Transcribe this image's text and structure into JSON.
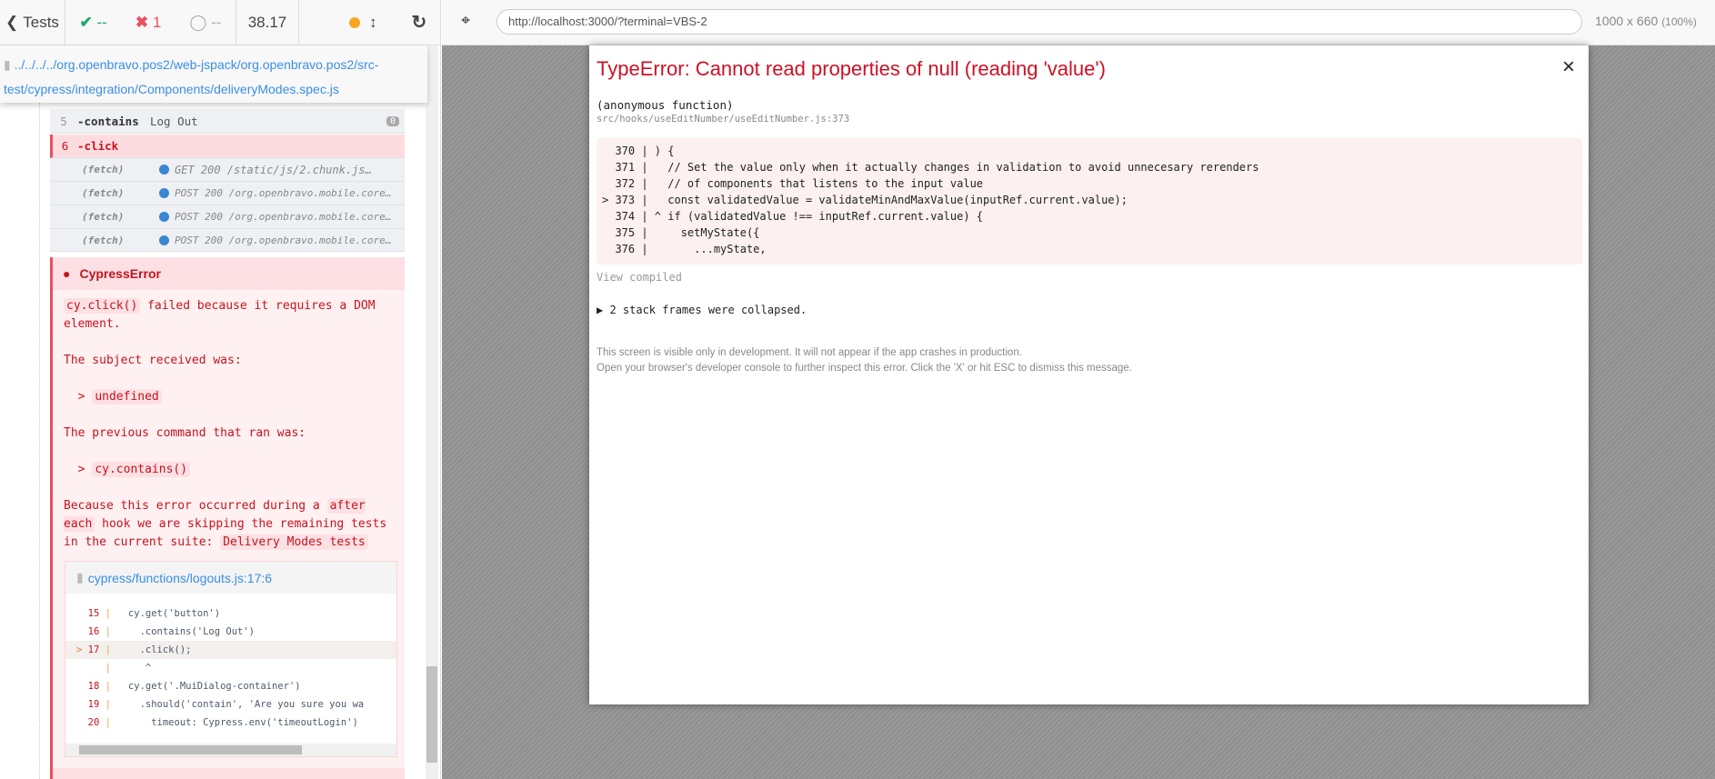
{
  "reporter": {
    "back_label": "Tests",
    "passed": "--",
    "failed": "1",
    "pending": "--",
    "duration": "38.17",
    "spec_path_line1": "../../../../org.openbravo.pos2/web-jspack/org.openbravo.pos2/src-",
    "spec_path_line2": "test/cypress/integration/Components/deliveryModes.spec.js",
    "commands": [
      {
        "num": "5",
        "name": "-contains",
        "message": "Log Out",
        "badge": "0"
      },
      {
        "num": "6",
        "name": "-click",
        "message": ""
      }
    ],
    "fetches": [
      {
        "label": "(fetch)",
        "text": "GET 200 /static/js/2.chunk.js…"
      },
      {
        "label": "(fetch)",
        "text": "POST 200 /org.openbravo.mobile.core…"
      },
      {
        "label": "(fetch)",
        "text": "POST 200 /org.openbravo.mobile.core…"
      },
      {
        "label": "(fetch)",
        "text": "POST 200 /org.openbravo.mobile.core…"
      }
    ],
    "error": {
      "title": "CypressError",
      "m1_code": "cy.click()",
      "m1_text": " failed because it requires a DOM element.",
      "m2": "The subject received was:",
      "m2_code": "undefined",
      "m3": "The previous command that ran was:",
      "m3_code": "cy.contains()",
      "m4a": "Because this error occurred during a ",
      "m4_code1": "after each",
      "m4b": " hook we are skipping the remaining tests in the current suite: ",
      "m4_code2": "Delivery Modes tests",
      "frame_file": "cypress/functions/logouts.js:17:6",
      "code_lines": [
        {
          "marker": "  ",
          "num": "15",
          "code": "  cy.get('button')"
        },
        {
          "marker": "  ",
          "num": "16",
          "code": "    .contains('Log Out')"
        },
        {
          "marker": "> ",
          "num": "17",
          "code": "    .click();"
        },
        {
          "marker": "  ",
          "num": "  ",
          "code": "     ^"
        },
        {
          "marker": "  ",
          "num": "18",
          "code": "  cy.get('.MuiDialog-container')"
        },
        {
          "marker": "  ",
          "num": "19",
          "code": "    .should('contain', 'Are you sure you wa"
        },
        {
          "marker": "  ",
          "num": "20",
          "code": "      timeout: Cypress.env('timeoutLogin')"
        }
      ]
    }
  },
  "browser": {
    "url": "http://localhost:3000/?terminal=VBS-2",
    "viewport": "1000 x 660",
    "zoom": "(100%)"
  },
  "overlay": {
    "title": "TypeError: Cannot read properties of null (reading 'value')",
    "close": "×",
    "fn": "(anonymous function)",
    "file": "src/hooks/useEditNumber/useEditNumber.js:373",
    "lines": [
      "  370 | ) {",
      "  371 |   // Set the value only when it actually changes in validation to avoid unnecesary rerenders",
      "  372 |   // of components that listens to the input value",
      "> 373 |   const validatedValue = validateMinAndMaxValue(inputRef.current.value);",
      "  374 | ^ if (validatedValue !== inputRef.current.value) {",
      "  375 |     setMyState({",
      "  376 |       ...myState,"
    ],
    "view_compiled": "View compiled",
    "collapsed": "▶ 2 stack frames were collapsed.",
    "footer1": "This screen is visible only in development. It will not appear if the app crashes in production.",
    "footer2": "Open your browser's developer console to further inspect this error.  Click the 'X' or hit ESC to dismiss this message."
  }
}
